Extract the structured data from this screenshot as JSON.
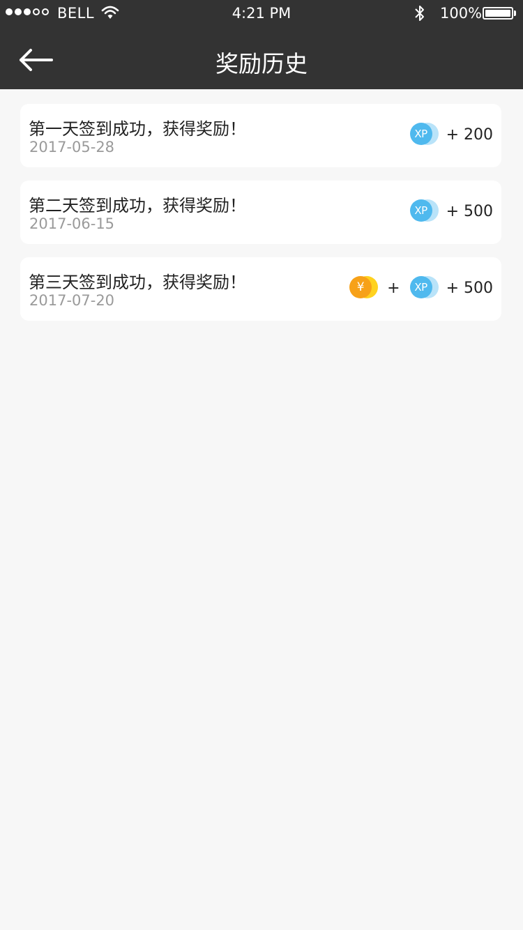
{
  "status_bar": {
    "carrier": "BELL",
    "time": "4:21 PM",
    "battery": "100%"
  },
  "header": {
    "title": "奖励历史"
  },
  "records": [
    {
      "title": "第一天签到成功，获得奖励！",
      "date": "2017-05-28",
      "reward_text": "+ 200",
      "coin_label": "XP"
    },
    {
      "title": "第二天签到成功，获得奖励！",
      "date": "2017-06-15",
      "reward_text": "+ 500",
      "coin_label": "XP"
    },
    {
      "title": "第三天签到成功，获得奖励！",
      "date": "2017-07-20",
      "reward_text": "+ 500",
      "coin_label": "XP",
      "yen_label": "¥",
      "plus": "+"
    }
  ],
  "colors": {
    "navbar": "#333333",
    "background": "#f7f7f7",
    "xp_coin": "#4fb9ee",
    "yen_coin": "#f7a118"
  },
  "icons": {
    "back": "back-arrow-icon",
    "wifi": "wifi-icon",
    "bluetooth": "bluetooth-icon",
    "battery": "battery-icon",
    "xp": "xp-coin-icon",
    "yen": "yen-coin-icon"
  }
}
